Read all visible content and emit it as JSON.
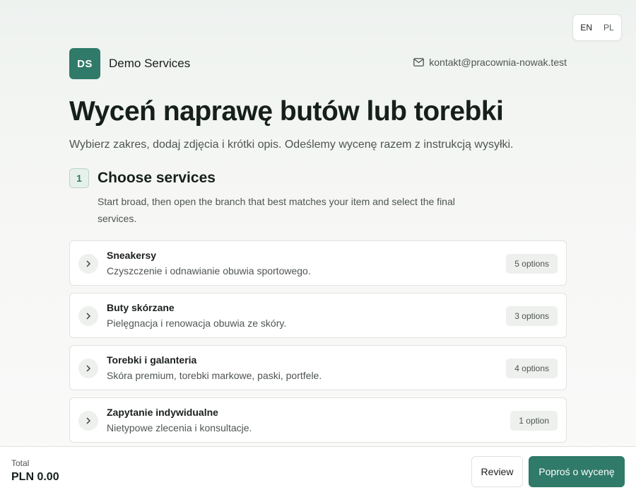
{
  "language": {
    "options": [
      "EN",
      "PL"
    ],
    "selected": "EN"
  },
  "brand": {
    "initials": "DS",
    "name": "Demo Services"
  },
  "contact": {
    "email": "kontakt@pracownia-nowak.test",
    "icon": "mail-icon"
  },
  "hero": {
    "title": "Wyceń naprawę butów lub torebki",
    "subtitle": "Wybierz zakres, dodaj zdjęcia i krótki opis. Odeślemy wycenę razem z instrukcją wysyłki."
  },
  "step": {
    "number": "1",
    "title": "Choose services",
    "description": "Start broad, then open the branch that best matches your item and select the final services."
  },
  "categories": [
    {
      "name": "Sneakersy",
      "description": "Czyszczenie i odnawianie obuwia sportowego.",
      "badge": "5 options"
    },
    {
      "name": "Buty skórzane",
      "description": "Pielęgnacja i renowacja obuwia ze skóry.",
      "badge": "3 options"
    },
    {
      "name": "Torebki i galanteria",
      "description": "Skóra premium, torebki markowe, paski, portfele.",
      "badge": "4 options"
    },
    {
      "name": "Zapytanie indywidualne",
      "description": "Nietypowe zlecenia i konsultacje.",
      "badge": "1 option"
    }
  ],
  "footer": {
    "total_label": "Total",
    "total_value": "PLN 0.00",
    "review_label": "Review",
    "primary_label": "Poproś o wycenę"
  },
  "colors": {
    "accent": "#2f7a68",
    "accent_soft": "#e7f1ec",
    "border": "#dfe3e0"
  }
}
